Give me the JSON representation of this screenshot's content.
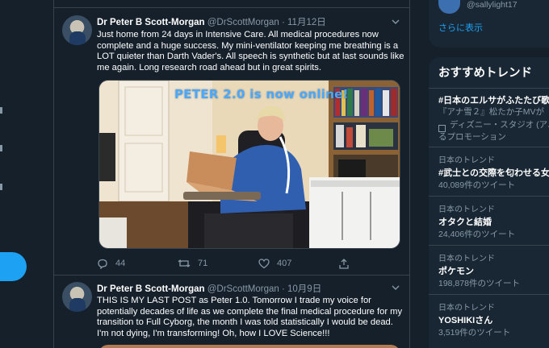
{
  "user": {
    "handle": "@sallylight17"
  },
  "sidebar": {
    "show_more": "さらに表示"
  },
  "trends": {
    "title": "おすすめトレンド",
    "promoted": {
      "name": "#日本のエルサがふたたび歌う",
      "description": "『アナ雪２』松たか子MVが",
      "promoter": "ディズニー・スタジオ (アニ",
      "promoter_suffix": "るプロモーション"
    },
    "items": [
      {
        "context": "日本のトレンド",
        "name": "#武士との交際を匂わせる女",
        "count": "40,089件のツイート"
      },
      {
        "context": "日本のトレンド",
        "name": "オタクと結婚",
        "count": "24,406件のツイート"
      },
      {
        "context": "日本のトレンド",
        "name": "ポケモン",
        "count": "198,878件のツイート"
      },
      {
        "context": "日本のトレンド",
        "name": "YOSHIKIさん",
        "count": "3,519件のツイート"
      }
    ]
  },
  "tweets": [
    {
      "name": "Dr Peter B Scott-Morgan",
      "handle": "@DrScottMorgan",
      "separator": "·",
      "date": "11月12日",
      "text": "Just home from 24 days in Intensive Care. All medical procedures now complete and a huge success. My mini-ventilator keeping me breathing is a LOT quieter than Darth Vader's. All speech is synthetic but at last sounds like me again. Long research road ahead but in great spirits.",
      "image_caption": "PETER 2.0 is now online!",
      "replies": "44",
      "retweets": "71",
      "likes": "407"
    },
    {
      "name": "Dr Peter B Scott-Morgan",
      "handle": "@DrScottMorgan",
      "separator": "·",
      "date": "10月9日",
      "text": "THIS IS MY LAST POST as Peter 1.0. Tomorrow I trade my voice for potentially decades of life as we complete the final medical procedure for my transition to Full Cyborg, the month I was told statistically I would be dead. I'm not dying, I'm transforming! Oh, how I LOVE Science!!!"
    }
  ],
  "icons": {
    "reply": "reply-icon",
    "retweet": "retweet-icon",
    "like": "heart-icon",
    "share": "share-icon",
    "chevron": "chevron-down-icon"
  },
  "colors": {
    "background": "#15202b",
    "panel": "#192734",
    "accent": "#1da1f2",
    "muted": "#8899a6",
    "border": "#38444d"
  }
}
